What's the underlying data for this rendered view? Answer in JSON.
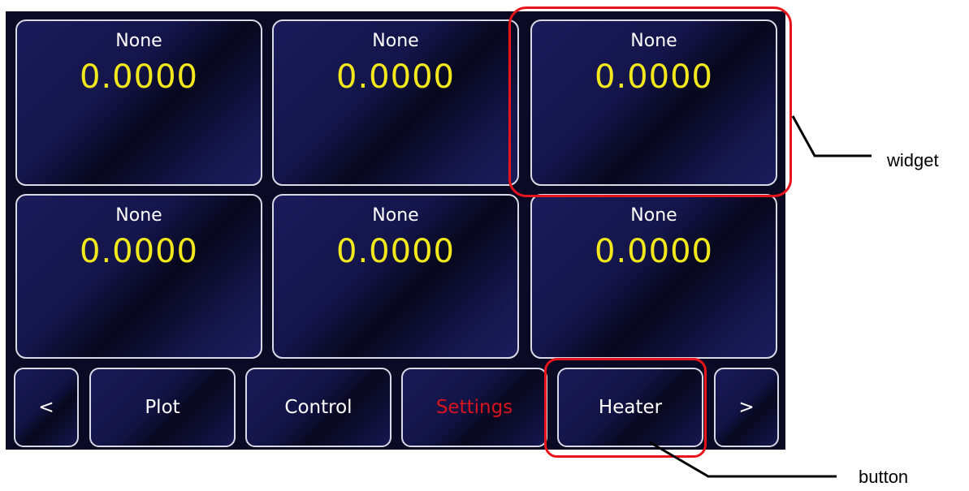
{
  "widgets": [
    {
      "name": "None",
      "value": "0.0000"
    },
    {
      "name": "None",
      "value": "0.0000"
    },
    {
      "name": "None",
      "value": "0.0000"
    },
    {
      "name": "None",
      "value": "0.0000"
    },
    {
      "name": "None",
      "value": "0.0000"
    },
    {
      "name": "None",
      "value": "0.0000"
    }
  ],
  "nav": {
    "prev_label": "<",
    "plot_label": "Plot",
    "control_label": "Control",
    "settings_label": "Settings",
    "heater_label": "Heater",
    "next_label": ">"
  },
  "annotations": {
    "widget_label": "widget",
    "button_label": "button"
  },
  "colors": {
    "value_text": "#f2e81c",
    "active_button_text": "#d8141e",
    "highlight": "#e8141c"
  }
}
